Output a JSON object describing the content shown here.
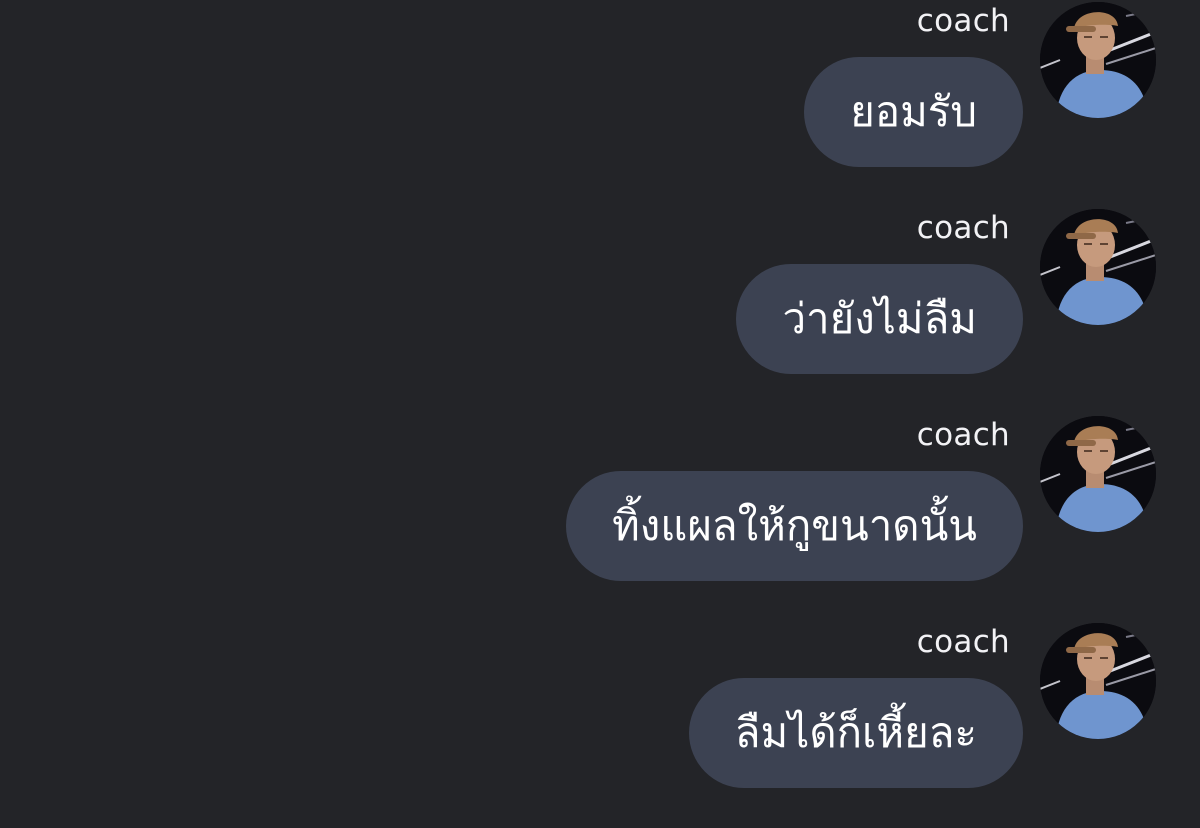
{
  "colors": {
    "background": "#232428",
    "bubble": "#3c4252",
    "text": "#ffffff",
    "sender_text": "#f2f2f5"
  },
  "messages": [
    {
      "sender": "coach",
      "text": "ยอมรับ",
      "avatar": "user-avatar-photo"
    },
    {
      "sender": "coach",
      "text": "ว่ายังไม่ลืม",
      "avatar": "user-avatar-photo"
    },
    {
      "sender": "coach",
      "text": "ทิ้งแผลให้กูขนาดนั้น",
      "avatar": "user-avatar-photo"
    },
    {
      "sender": "coach",
      "text": "ลืมได้ก็เหี้ยละ",
      "avatar": "user-avatar-photo"
    }
  ]
}
